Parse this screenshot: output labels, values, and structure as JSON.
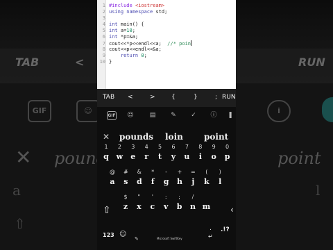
{
  "editor": {
    "lines": [
      {
        "n": "1",
        "parts": [
          {
            "c": "pp",
            "t": "#include "
          },
          {
            "c": "str",
            "t": "<iostream>"
          }
        ]
      },
      {
        "n": "2",
        "parts": [
          {
            "c": "kw",
            "t": "using namespace "
          },
          {
            "c": "tx",
            "t": "std;"
          }
        ]
      },
      {
        "n": "3",
        "parts": []
      },
      {
        "n": "4",
        "parts": [
          {
            "c": "kw",
            "t": "int "
          },
          {
            "c": "tx",
            "t": "main() {"
          }
        ]
      },
      {
        "n": "5",
        "parts": [
          {
            "c": "kw",
            "t": "int "
          },
          {
            "c": "tx",
            "t": "a="
          },
          {
            "c": "num",
            "t": "10"
          },
          {
            "c": "tx",
            "t": ";"
          }
        ]
      },
      {
        "n": "6",
        "parts": [
          {
            "c": "kw",
            "t": "int "
          },
          {
            "c": "tx",
            "t": "*p=&a;"
          }
        ]
      },
      {
        "n": "7",
        "parts": [
          {
            "c": "tx",
            "t": "cout<<*p<<endl<<a;  "
          },
          {
            "c": "cm",
            "t": "//* poin"
          }
        ]
      },
      {
        "n": "8",
        "parts": [
          {
            "c": "tx",
            "t": "cout<<p<<endl<<&a;"
          }
        ]
      },
      {
        "n": "9",
        "parts": [
          {
            "c": "kw",
            "t": "    return "
          },
          {
            "c": "num",
            "t": "0"
          },
          {
            "c": "tx",
            "t": ";"
          }
        ]
      },
      {
        "n": "10",
        "parts": [
          {
            "c": "tx",
            "t": "}"
          }
        ]
      }
    ]
  },
  "keybar": {
    "tab": "TAB",
    "left": "<",
    "right": ">",
    "open_brace": "{",
    "close_brace": "}",
    "semicolon": ";",
    "run": "RUN"
  },
  "toolbar": {
    "gif_label": "GIF",
    "icons": [
      "gif-icon",
      "sticker-icon",
      "clipboard-icon",
      "translate-icon",
      "checkmark-icon",
      "info-icon",
      "mic-icon"
    ]
  },
  "suggestions": {
    "close": "✕",
    "items": [
      "pounds",
      "loin",
      "point"
    ]
  },
  "keys": {
    "row1": [
      {
        "sub": "1",
        "k": "q"
      },
      {
        "sub": "2",
        "k": "w"
      },
      {
        "sub": "3",
        "k": "e"
      },
      {
        "sub": "4",
        "k": "r"
      },
      {
        "sub": "5",
        "k": "t"
      },
      {
        "sub": "6",
        "k": "y"
      },
      {
        "sub": "7",
        "k": "u"
      },
      {
        "sub": "8",
        "k": "i"
      },
      {
        "sub": "9",
        "k": "o"
      },
      {
        "sub": "0",
        "k": "p"
      }
    ],
    "row2": [
      {
        "sub": "@",
        "k": "a"
      },
      {
        "sub": "#",
        "k": "s"
      },
      {
        "sub": "&",
        "k": "d"
      },
      {
        "sub": "*",
        "k": "f"
      },
      {
        "sub": "-",
        "k": "g"
      },
      {
        "sub": "+",
        "k": "h"
      },
      {
        "sub": "=",
        "k": "j"
      },
      {
        "sub": "(",
        "k": "k"
      },
      {
        "sub": ")",
        "k": "l"
      }
    ],
    "row3": [
      {
        "sub": "$",
        "k": "z"
      },
      {
        "sub": "\"",
        "k": "x"
      },
      {
        "sub": "'",
        "k": "c"
      },
      {
        "sub": ":",
        "k": "v"
      },
      {
        "sub": ";",
        "k": "b"
      },
      {
        "sub": "/",
        "k": "n"
      },
      {
        "sub": "",
        "k": "m"
      }
    ],
    "shift": "⇧",
    "backspace": "‹",
    "num_toggle": "123",
    "emoji": "☺",
    "mic_small": "✎",
    "space_label": "Microsoft SwiftKey",
    "period": ".",
    "punct": ".!?",
    "enter": "↵"
  },
  "background": {
    "tab": "TAB",
    "left": "<",
    "run": "RUN",
    "ghost_left_word": "pounds",
    "ghost_right_word": "point"
  }
}
